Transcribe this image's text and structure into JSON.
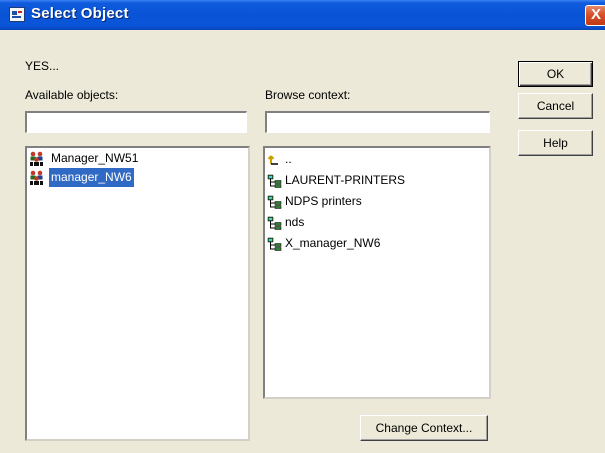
{
  "window": {
    "title": "Select Object",
    "close_glyph": "X"
  },
  "message": "YES...",
  "available": {
    "label": "Available objects:",
    "filter_value": "",
    "items": [
      {
        "label": "Manager_NW51",
        "icon": "user-group-icon",
        "selected": false
      },
      {
        "label": "manager_NW6",
        "icon": "user-group-icon",
        "selected": true
      }
    ]
  },
  "browse": {
    "label": "Browse context:",
    "filter_value": "",
    "items": [
      {
        "label": "..",
        "icon": "parent-folder-icon"
      },
      {
        "label": "LAURENT-PRINTERS",
        "icon": "container-icon"
      },
      {
        "label": "NDPS printers",
        "icon": "container-icon"
      },
      {
        "label": "nds",
        "icon": "container-icon"
      },
      {
        "label": "X_manager_NW6",
        "icon": "container-icon"
      }
    ]
  },
  "buttons": {
    "ok": "OK",
    "cancel": "Cancel",
    "help": "Help",
    "change_context": "Change Context..."
  },
  "colors": {
    "title_bar": "#0853D6",
    "selection": "#316AC5",
    "dialog_bg": "#ECE9D8"
  }
}
